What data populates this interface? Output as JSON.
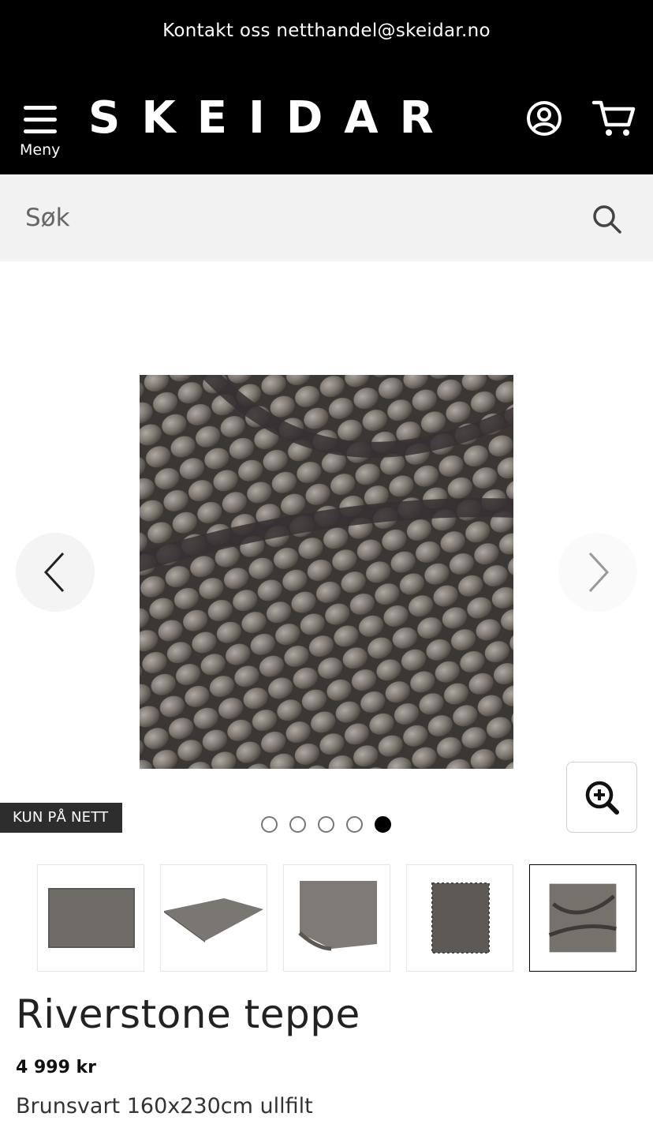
{
  "header": {
    "contact_text": "Kontakt oss netthandel@skeidar.no",
    "menu_label": "Meny",
    "logo_text": "SKEIDAR",
    "icons": {
      "account": "account-icon",
      "cart": "cart-icon",
      "menu": "hamburger-icon"
    }
  },
  "search": {
    "placeholder": "Søk",
    "icon": "search-icon"
  },
  "gallery": {
    "badge": "KUN PÅ NETT",
    "image_count": 5,
    "active_index": 5,
    "icons": {
      "prev": "chevron-left-icon",
      "next": "chevron-right-icon",
      "zoom": "zoom-in-icon"
    }
  },
  "product": {
    "title": "Riverstone teppe",
    "price": "4 999 kr",
    "variant": "Brunsvart 160x230cm ullfilt"
  },
  "colors": {
    "header_bg": "#000000",
    "search_bg": "#f2f2f2",
    "badge_bg": "#2d2d2d",
    "rug": "#6e6a66"
  }
}
